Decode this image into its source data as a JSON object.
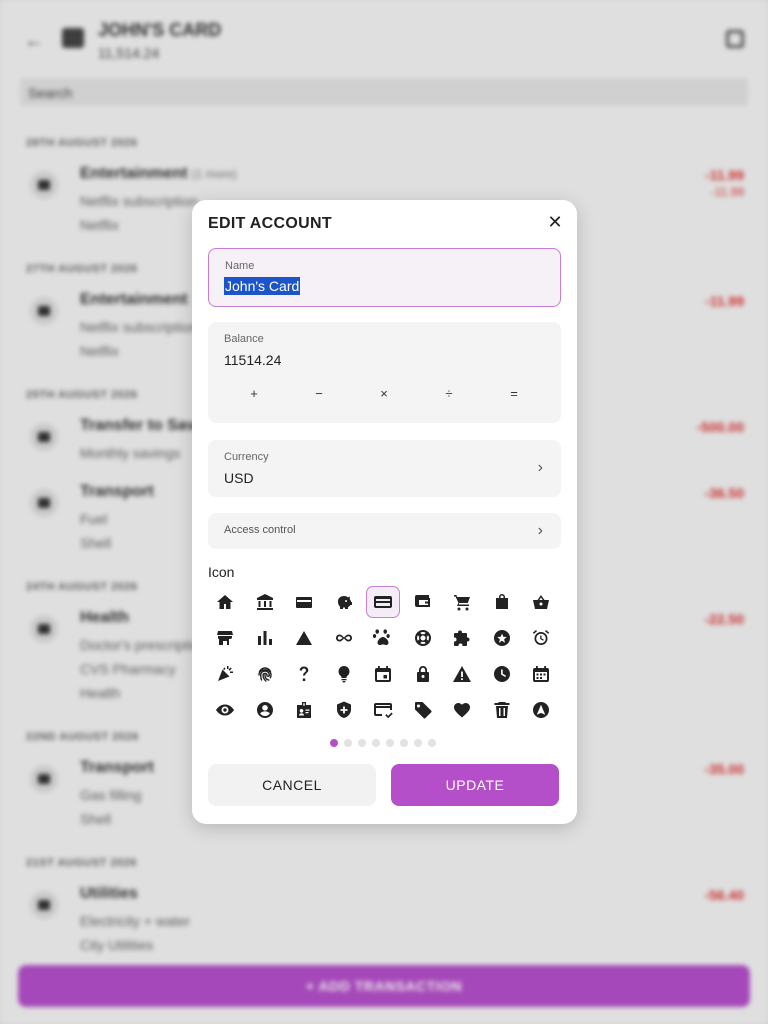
{
  "background": {
    "account_name": "JOHN'S CARD",
    "account_balance": "11,514.24",
    "search_placeholder": "Search",
    "add_button": "ADD TRANSACTION",
    "groups": [
      {
        "date": "28TH AUGUST 2026",
        "transactions": [
          {
            "category": "Entertainment",
            "sub": "(1 more)",
            "lines": [
              "Netflix subscription",
              "Netflix"
            ],
            "amount": "-11.99",
            "amount2": "-11.99"
          }
        ]
      },
      {
        "date": "27TH AUGUST 2026",
        "transactions": [
          {
            "category": "Entertainment",
            "sub": "",
            "lines": [
              "Netflix subscription",
              "Netflix"
            ],
            "amount": "-11.99"
          }
        ]
      },
      {
        "date": "25TH AUGUST 2026",
        "transactions": [
          {
            "category": "Transfer to Savings",
            "sub": "",
            "lines": [
              "Monthly savings"
            ],
            "amount": "-500.00"
          },
          {
            "category": "Transport",
            "sub": "",
            "lines": [
              "Fuel",
              "Shell"
            ],
            "amount": "-36.50"
          }
        ]
      },
      {
        "date": "24TH AUGUST 2026",
        "transactions": [
          {
            "category": "Health",
            "sub": "",
            "lines": [
              "Doctor's prescription",
              "CVS Pharmacy",
              "Health"
            ],
            "amount": "-22.50"
          }
        ]
      },
      {
        "date": "22ND AUGUST 2026",
        "transactions": [
          {
            "category": "Transport",
            "sub": "",
            "lines": [
              "Gas filling",
              "Shell"
            ],
            "amount": "-35.00"
          }
        ]
      },
      {
        "date": "21ST AUGUST 2026",
        "transactions": [
          {
            "category": "Utilities",
            "sub": "",
            "lines": [
              "Electricity + water",
              "City Utilities"
            ],
            "amount": "-56.40"
          }
        ]
      }
    ]
  },
  "dialog": {
    "title": "EDIT ACCOUNT",
    "close_icon": "close-icon",
    "name": {
      "label": "Name",
      "value": "John's Card"
    },
    "balance": {
      "label": "Balance",
      "value": "11514.24",
      "ops": [
        "+",
        "−",
        "×",
        "÷",
        "="
      ]
    },
    "currency": {
      "label": "Currency",
      "value": "USD"
    },
    "access": {
      "label": "Access control"
    },
    "icon_section_label": "Icon",
    "selected_icon_index": 4,
    "icons": [
      "home-icon",
      "bank-icon",
      "wallet-icon",
      "piggy-bank-icon",
      "credit-card-icon",
      "card-wallet-icon",
      "cart-icon",
      "shopping-bag-icon",
      "basket-icon",
      "store-icon",
      "bar-chart-icon",
      "triangle-icon",
      "infinity-icon",
      "paw-icon",
      "life-ring-icon",
      "puzzle-icon",
      "star-circle-icon",
      "alarm-icon",
      "party-popper-icon",
      "fingerprint-icon",
      "question-icon",
      "lightbulb-icon",
      "calendar-event-icon",
      "lock-icon",
      "warning-icon",
      "clock-icon",
      "calendar-icon",
      "eye-icon",
      "account-circle-icon",
      "badge-icon",
      "shield-plus-icon",
      "card-check-icon",
      "tag-icon",
      "heart-icon",
      "trash-icon",
      "navigation-icon"
    ],
    "page_count": 8,
    "active_page": 0,
    "cancel_label": "CANCEL",
    "update_label": "UPDATE",
    "accent_color": "#b44fc9"
  }
}
